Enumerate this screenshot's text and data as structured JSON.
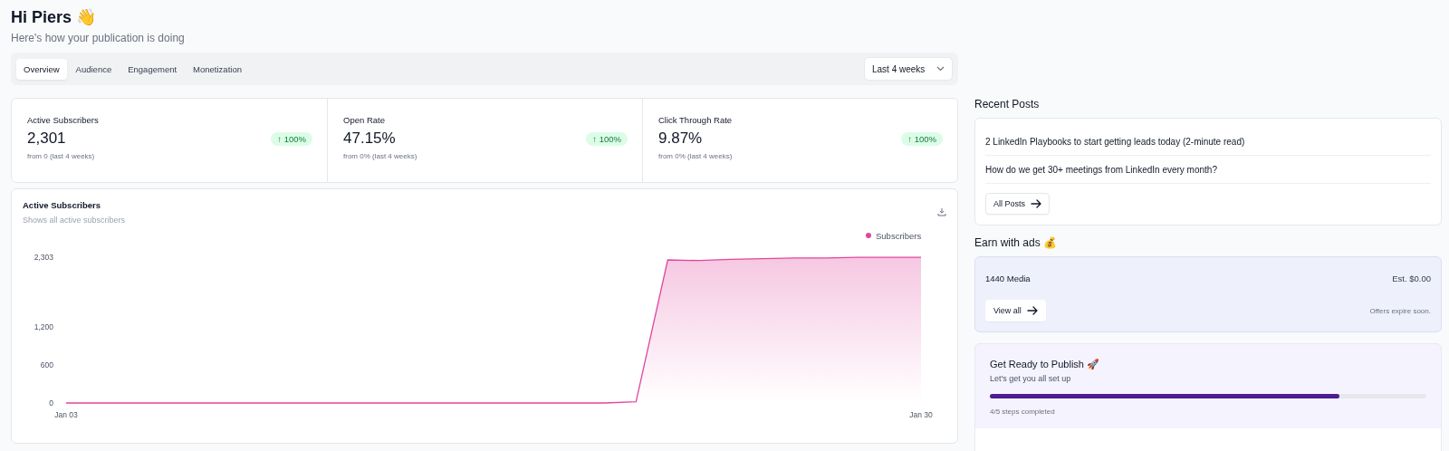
{
  "greeting": {
    "title": "Hi Piers 👋",
    "subtitle": "Here's how your publication is doing"
  },
  "tabs": [
    {
      "label": "Overview",
      "selected": true
    },
    {
      "label": "Audience",
      "selected": false
    },
    {
      "label": "Engagement",
      "selected": false
    },
    {
      "label": "Monetization",
      "selected": false
    }
  ],
  "period": {
    "value": "Last 4 weeks"
  },
  "stats": [
    {
      "label": "Active Subscribers",
      "value": "2,301",
      "change": "↑ 100%",
      "note": "from 0 (last 4 weeks)"
    },
    {
      "label": "Open Rate",
      "value": "47.15%",
      "change": "↑ 100%",
      "note": "from 0% (last 4 weeks)"
    },
    {
      "label": "Click Through Rate",
      "value": "9.87%",
      "change": "↑ 100%",
      "note": "from 0% (last 4 weeks)"
    }
  ],
  "chart_card": {
    "title": "Active Subscribers",
    "subtitle": "Shows all active subscribers",
    "chart_data": {
      "type": "area",
      "categories": [
        "Jan 03",
        null,
        null,
        null,
        null,
        null,
        null,
        null,
        null,
        null,
        null,
        null,
        null,
        null,
        null,
        null,
        null,
        null,
        null,
        null,
        null,
        null,
        null,
        null,
        null,
        null,
        null,
        "Jan 30"
      ],
      "ylim": [
        0,
        2303
      ],
      "yticks": [
        {
          "value": 0,
          "label": "0"
        },
        {
          "value": 600,
          "label": "600"
        },
        {
          "value": 1200,
          "label": "1,200"
        },
        {
          "value": 2303,
          "label": "2,303"
        }
      ],
      "series": [
        {
          "name": "Subscribers",
          "color": "#e0479e",
          "values": [
            0,
            0,
            0,
            0,
            0,
            0,
            0,
            0,
            0,
            0,
            0,
            0,
            0,
            0,
            0,
            0,
            0,
            0,
            20,
            2260,
            2250,
            2270,
            2280,
            2290,
            2290,
            2300,
            2300,
            2300
          ]
        }
      ]
    }
  },
  "recent_posts": {
    "title": "Recent Posts",
    "items": [
      "2 LinkedIn Playbooks to start getting leads today (2-minute read)",
      "How do we get 30+ meetings from LinkedIn every month?"
    ],
    "button": "All Posts"
  },
  "ads": {
    "title": "Earn with ads 💰",
    "name": "1440 Media",
    "estimate": "Est. $0.00",
    "button": "View all",
    "note": "Offers expire soon."
  },
  "publish": {
    "title": "Get Ready to Publish 🚀",
    "subtitle": "Let's get you all set up",
    "level": 0.8,
    "progress_text": "4/5 steps completed"
  }
}
